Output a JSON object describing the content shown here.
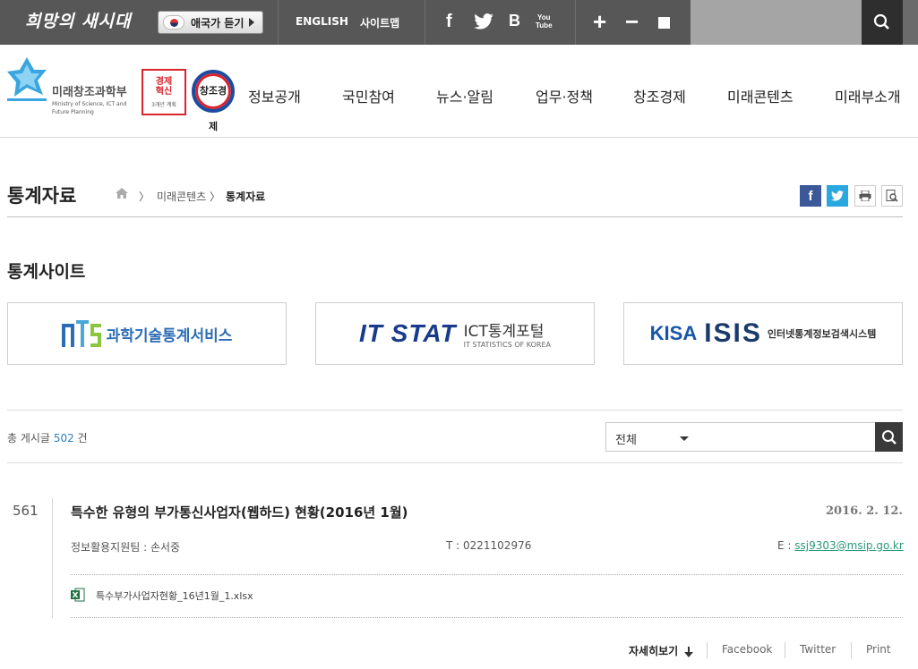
{
  "topbar": {
    "slogan": "희망의 새시대",
    "anthem_label": "애국가 듣기",
    "english": "ENGLISH",
    "sitemap": "사이트맵",
    "sns": {
      "facebook": "f",
      "blog": "B",
      "youtube_1": "You",
      "youtube_2": "Tube"
    },
    "zoom_in": "+",
    "zoom_out": "−"
  },
  "header": {
    "logo_ko": "미래창조과학부",
    "logo_en_1": "Ministry of Science, ICT and",
    "logo_en_2": "Future Planning",
    "emblem1_line1": "경제",
    "emblem1_line2": "혁신",
    "emblem1_sub": "3개년 계획",
    "emblem2": "창조경제",
    "nav": [
      "정보공개",
      "국민참여",
      "뉴스·알림",
      "업무·정책",
      "창조경제",
      "미래콘텐츠",
      "미래부소개"
    ]
  },
  "page": {
    "title": "통계자료",
    "breadcrumb": [
      "미래콘텐츠",
      "통계자료"
    ],
    "separator": "〉"
  },
  "stat_sites": {
    "title": "통계사이트",
    "ntis_text": "과학기술통계서비스",
    "itstat_logo": "IT STAT",
    "itstat_ko": "ICT통계포털",
    "itstat_en": "IT STATISTICS OF KOREA",
    "kisa": "KISA",
    "isis": "ISIS",
    "isis_text": "인터넷통계정보검색시스템"
  },
  "list": {
    "total_prefix": "총 게시글",
    "total_count": "502",
    "total_suffix": "건",
    "filter_value": "전체"
  },
  "post": {
    "number": "561",
    "title": "특수한 유형의 부가통신사업자(웹하드) 현황(2016년 1월)",
    "date": "2016. 2. 12.",
    "dept": "정보활용지원팀 : 손서중",
    "tel": "T : 0221102976",
    "email_prefix": "E : ",
    "email": "ssj9303@msip.go.kr",
    "file": "특수부가사업자현황_16년1월_1.xlsx",
    "detail": "자세히보기",
    "facebook": "Facebook",
    "twitter": "Twitter",
    "print": "Print"
  },
  "colors": {
    "topbar": "#575757",
    "facebook_blue": "#3b5998",
    "twitter_blue": "#29a8e0",
    "link_blue": "#2a7fc4",
    "email_green": "#2a9a7a"
  }
}
